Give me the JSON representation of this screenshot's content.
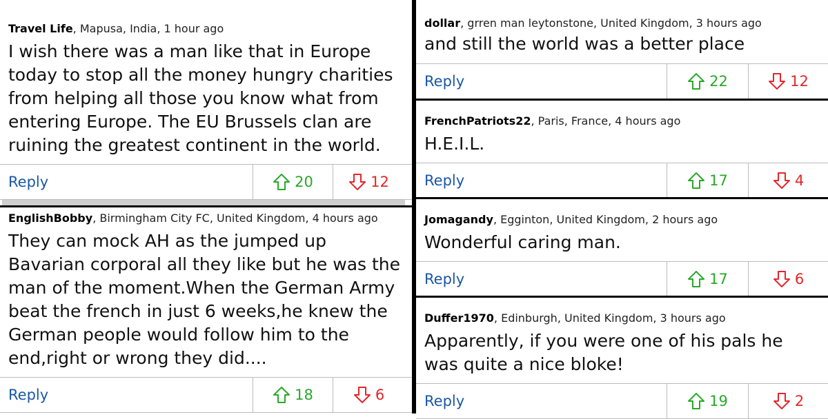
{
  "left": [
    {
      "user": "Travel Life",
      "location": ", Mapusa, India, 1 hour ago",
      "text": "I wish there was a man like that in Europe today to stop all the money hungry charities from helping all those you know what from entering Europe. The EU Brussels clan are ruining the greatest continent in the world.",
      "reply": "Reply",
      "up": "20",
      "down": "12"
    },
    {
      "user": "EnglishBobby",
      "location": ", Birmingham City FC, United Kingdom, 4 hours ago",
      "text": "They can mock AH as the jumped up Bavarian corporal all they like but he was the man of the moment.When the German Army beat the french in just 6 weeks,he knew the German people would follow him to the end,right or wrong they did....",
      "reply": "Reply",
      "up": "18",
      "down": "6"
    }
  ],
  "right": [
    {
      "user": "dollar",
      "location": ", grren man leytonstone, United Kingdom, 3 hours ago",
      "text": "and still the world was a better place",
      "reply": "Reply",
      "up": "22",
      "down": "12"
    },
    {
      "user": "FrenchPatriots22",
      "location": ", Paris, France, 4 hours ago",
      "text": "H.E.I.L.",
      "reply": "Reply",
      "up": "17",
      "down": "4"
    },
    {
      "user": "Jomagandy",
      "location": ", Egginton, United Kingdom, 2 hours ago",
      "text": "Wonderful caring man.",
      "reply": "Reply",
      "up": "17",
      "down": "6"
    },
    {
      "user": "Duffer1970",
      "location": ", Edinburgh, United Kingdom, 3 hours ago",
      "text": "Apparently, if you were one of his pals he was quite a nice bloke!",
      "reply": "Reply",
      "up": "19",
      "down": "2"
    }
  ],
  "colors": {
    "reply": "#1a57a6",
    "upvote": "#28a828",
    "downvote": "#e3262a"
  },
  "icons": {
    "upvote": "arrow-up-outline-icon",
    "downvote": "arrow-down-outline-icon"
  }
}
